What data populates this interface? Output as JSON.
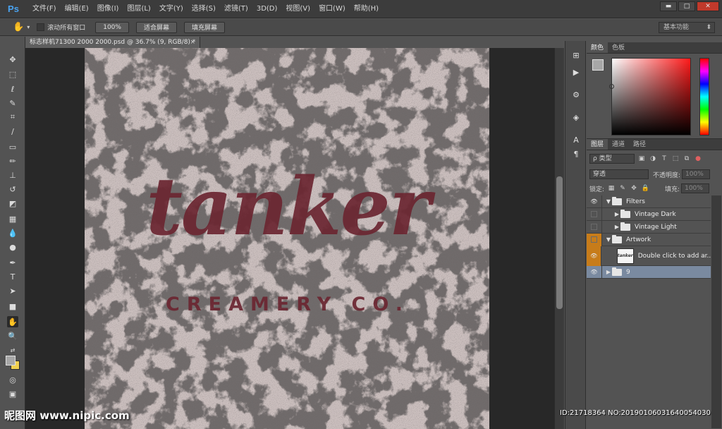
{
  "app": {
    "logo": "Ps"
  },
  "menu": [
    "文件(F)",
    "编辑(E)",
    "图像(I)",
    "图层(L)",
    "文字(Y)",
    "选择(S)",
    "滤镜(T)",
    "3D(D)",
    "视图(V)",
    "窗口(W)",
    "帮助(H)"
  ],
  "window_controls": {
    "minimize": "▬",
    "maximize": "□",
    "close": "✕"
  },
  "options": {
    "scroll_all_label": "滚动所有窗口",
    "zoom_btn": "100%",
    "fit_btn": "适合屏幕",
    "fill_btn": "填充屏幕",
    "workspace": "基本功能"
  },
  "document": {
    "tab_title": "标志样机71300 2000 2000.psd @ 36.7% (9, RGB/8) *",
    "tab_close": "×",
    "logo_word": "tanker",
    "logo_sub": "CREAMERY CO."
  },
  "color_panel": {
    "tabs": [
      "颜色",
      "色板"
    ],
    "fg": "#a7a7a7",
    "bg": "#f0d050"
  },
  "layers_panel": {
    "tabs": [
      "图层",
      "通道",
      "路径"
    ],
    "filter_kind": "ρ 类型",
    "blend_mode": "穿透",
    "opacity_label": "不透明度:",
    "opacity_value": "100%",
    "lock_label": "锁定:",
    "fill_label": "填充:",
    "fill_value": "100%",
    "layers": [
      {
        "name": "Filters",
        "type": "group-open",
        "indent": 0,
        "visible": true,
        "selected": false,
        "orange": false
      },
      {
        "name": "Vintage Dark",
        "type": "group-closed",
        "indent": 1,
        "visible": false,
        "selected": false,
        "orange": false
      },
      {
        "name": "Vintage Light",
        "type": "group-closed",
        "indent": 1,
        "visible": false,
        "selected": false,
        "orange": false
      },
      {
        "name": "Artwork",
        "type": "group-open",
        "indent": 0,
        "visible": false,
        "selected": false,
        "orange": true
      },
      {
        "name": "Double click to add ar...",
        "type": "smart",
        "indent": 1,
        "visible": true,
        "selected": false,
        "orange": true
      },
      {
        "name": "9",
        "type": "group-closed",
        "indent": 0,
        "visible": true,
        "selected": true,
        "orange": false
      }
    ]
  },
  "watermark": {
    "left": "昵图网 www.nipic.com",
    "right": "ID:21718364 NO:20190106031640054030"
  }
}
